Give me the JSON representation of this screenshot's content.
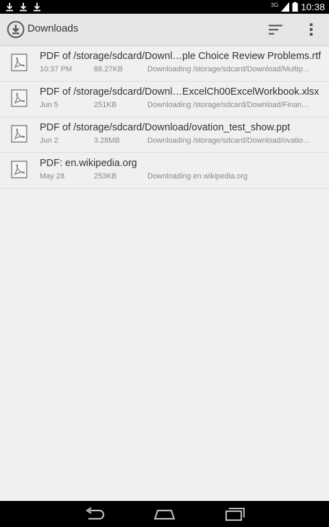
{
  "status_bar": {
    "notifications": [
      "download-icon",
      "download-icon",
      "download-icon"
    ],
    "network": "3G",
    "time": "10:38"
  },
  "action_bar": {
    "title": "Downloads",
    "icons": [
      "downloads-app-icon",
      "sort-icon",
      "overflow-menu-icon"
    ]
  },
  "downloads": [
    {
      "title": "PDF of /storage/sdcard/Downl…ple Choice Review Problems.rtf",
      "time": "10:37 PM",
      "size": "88.27KB",
      "status": "Downloading /storage/sdcard/Download/Multip…",
      "icon": "pdf-file-icon"
    },
    {
      "title": "PDF of /storage/sdcard/Downl…ExcelCh00ExcelWorkbook.xlsx",
      "time": "Jun 5",
      "size": "251KB",
      "status": "Downloading /storage/sdcard/Download/Finan…",
      "icon": "pdf-file-icon"
    },
    {
      "title": "PDF of /storage/sdcard/Download/ovation_test_show.ppt",
      "time": "Jun 2",
      "size": "3.28MB",
      "status": "Downloading /storage/sdcard/Download/ovatio…",
      "icon": "pdf-file-icon"
    },
    {
      "title": "PDF: en.wikipedia.org",
      "time": "May 28",
      "size": "253KB",
      "status": "Downloading en.wikipedia.org",
      "icon": "pdf-file-icon"
    }
  ],
  "nav_bar": {
    "buttons": [
      "back-icon",
      "home-icon",
      "recent-apps-icon"
    ]
  }
}
